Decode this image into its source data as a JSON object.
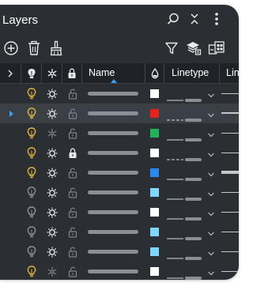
{
  "panel": {
    "title": "Layers"
  },
  "titlebar_icons": [
    "search-icon",
    "collapse-icon",
    "more-vertical-icon"
  ],
  "toolbar_icons": [
    "add-layer-icon",
    "delete-layer-icon",
    "purge-broom-icon",
    "filter-icon",
    "layer-states-icon",
    "layer-tools-icon"
  ],
  "columns": {
    "expand": "expand-column-icon",
    "on": "bulb-column-icon",
    "freeze": "snowflake-column-icon",
    "lock": "lock-column-icon",
    "name": "Name",
    "color": "color-drop-icon",
    "linetype": "Linetype",
    "lineweight": "Lin"
  },
  "colors": {
    "accent": "#3a9ff5",
    "bulb_on": "#e0b33a",
    "bulb_off": "#8e9399"
  },
  "layers": [
    {
      "current": false,
      "on": true,
      "frozen": false,
      "locked": false,
      "color": "#ffffff",
      "linetype": "solid",
      "lineweight": "thin"
    },
    {
      "current": true,
      "on": true,
      "frozen": false,
      "locked": false,
      "color": "#e8211c",
      "linetype": "dashed",
      "lineweight": "medium"
    },
    {
      "current": false,
      "on": true,
      "frozen": true,
      "locked": false,
      "color": "#21b15a",
      "linetype": "solid",
      "lineweight": "thin"
    },
    {
      "current": false,
      "on": true,
      "frozen": false,
      "locked": true,
      "color": "#ffffff",
      "linetype": "dashed",
      "lineweight": "thin"
    },
    {
      "current": false,
      "on": true,
      "frozen": false,
      "locked": false,
      "color": "#2b88f0",
      "linetype": "solid",
      "lineweight": "thick"
    },
    {
      "current": false,
      "on": false,
      "frozen": false,
      "locked": false,
      "color": "#7fd6ff",
      "linetype": "solid",
      "lineweight": "thin"
    },
    {
      "current": false,
      "on": false,
      "frozen": false,
      "locked": false,
      "color": "#ffffff",
      "linetype": "solid",
      "lineweight": "thin"
    },
    {
      "current": false,
      "on": false,
      "frozen": false,
      "locked": false,
      "color": "#7fd6ff",
      "linetype": "solid",
      "lineweight": "thin"
    },
    {
      "current": false,
      "on": false,
      "frozen": false,
      "locked": false,
      "color": "#7fd6ff",
      "linetype": "solid",
      "lineweight": "thin"
    },
    {
      "current": false,
      "on": true,
      "frozen": true,
      "locked": false,
      "color": "#ffffff",
      "linetype": "solid",
      "lineweight": "thin"
    }
  ]
}
